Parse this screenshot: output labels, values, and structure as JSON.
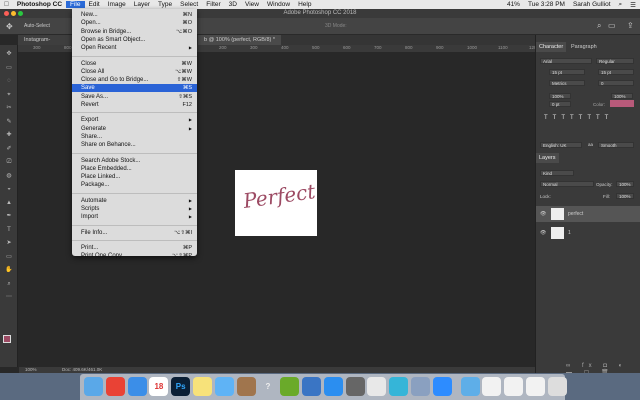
{
  "menubar": {
    "apple": "",
    "app": "Photoshop CC",
    "items": [
      "File",
      "Edit",
      "Image",
      "Layer",
      "Type",
      "Select",
      "Filter",
      "3D",
      "View",
      "Window",
      "Help"
    ],
    "active": "File",
    "battery": "41%",
    "clock": "Tue 3:28 PM",
    "user": "Sarah Gulliot"
  },
  "window": {
    "title": "Adobe Photoshop CC 2018"
  },
  "options": {
    "auto_select": "Auto-Select",
    "mode_3d": "3D Mode:"
  },
  "tabs": [
    {
      "label": "Instagram-Scre…"
    },
    {
      "label": "b @ 100% (perfect, RGB/8) *"
    }
  ],
  "ruler": [
    "300",
    "800",
    "100",
    "150",
    "0",
    "100",
    "200",
    "300",
    "400",
    "500",
    "600",
    "700",
    "800",
    "900",
    "1000",
    "1100",
    "1200"
  ],
  "canvas": {
    "text": "Perfect",
    "ink_color": "#9c4a63"
  },
  "status": {
    "zoom": "100%",
    "doc": "Doc: 409.6K/461.0K"
  },
  "file_menu": [
    {
      "label": "New...",
      "shortcut": "⌘N"
    },
    {
      "label": "Open...",
      "shortcut": "⌘O"
    },
    {
      "label": "Browse in Bridge...",
      "shortcut": "⌥⌘O"
    },
    {
      "label": "Open as Smart Object..."
    },
    {
      "label": "Open Recent",
      "submenu": true
    },
    {
      "sep": true
    },
    {
      "label": "Close",
      "shortcut": "⌘W"
    },
    {
      "label": "Close All",
      "shortcut": "⌥⌘W"
    },
    {
      "label": "Close and Go to Bridge...",
      "shortcut": "⇧⌘W"
    },
    {
      "label": "Save",
      "shortcut": "⌘S",
      "highlighted": true
    },
    {
      "label": "Save As...",
      "shortcut": "⇧⌘S"
    },
    {
      "label": "Revert",
      "shortcut": "F12"
    },
    {
      "sep": true
    },
    {
      "label": "Export",
      "submenu": true
    },
    {
      "label": "Generate",
      "submenu": true
    },
    {
      "label": "Share..."
    },
    {
      "label": "Share on Behance..."
    },
    {
      "sep": true
    },
    {
      "label": "Search Adobe Stock..."
    },
    {
      "label": "Place Embedded..."
    },
    {
      "label": "Place Linked..."
    },
    {
      "label": "Package..."
    },
    {
      "sep": true
    },
    {
      "label": "Automate",
      "submenu": true
    },
    {
      "label": "Scripts",
      "submenu": true
    },
    {
      "label": "Import",
      "submenu": true
    },
    {
      "sep": true
    },
    {
      "label": "File Info...",
      "shortcut": "⌥⇧⌘I"
    },
    {
      "sep": true
    },
    {
      "label": "Print...",
      "shortcut": "⌘P"
    },
    {
      "label": "Print One Copy",
      "shortcut": "⌥⇧⌘P"
    }
  ],
  "character": {
    "tabs": [
      "Character",
      "Paragraph"
    ],
    "font": "Arial",
    "style": "Regular",
    "size": "15 pt",
    "leading": "15 pt",
    "kerning": "Metrics",
    "tracking": "0",
    "vscale": "100%",
    "hscale": "100%",
    "baseline": "0 pt",
    "color_label": "Color:",
    "color": "#b85a7a",
    "language": "English: UK",
    "aa_label": "aa",
    "antialias": "Smooth"
  },
  "layers": {
    "tab": "Layers",
    "kind": "Kind",
    "blend": "Normal",
    "opacity_label": "Opacity:",
    "opacity": "100%",
    "lock_label": "Lock:",
    "fill_label": "Fill:",
    "fill": "100%",
    "items": [
      {
        "name": "perfect",
        "selected": true
      },
      {
        "name": "1"
      }
    ]
  },
  "dock": [
    "Finder",
    "Chrome",
    "Safari",
    "Calendar",
    "Ps",
    "Notes",
    "Messages",
    "Sketchbook",
    "Help",
    "Camtasia",
    "Keynote",
    "App Store",
    "Preferences",
    "Slack",
    "Sketch",
    "Photos",
    "Zoom",
    "Downloads",
    "Doc1",
    "Doc2",
    "Doc3",
    "Trash"
  ],
  "dock_calendar_day": "18",
  "dock_slack_badge": "1"
}
